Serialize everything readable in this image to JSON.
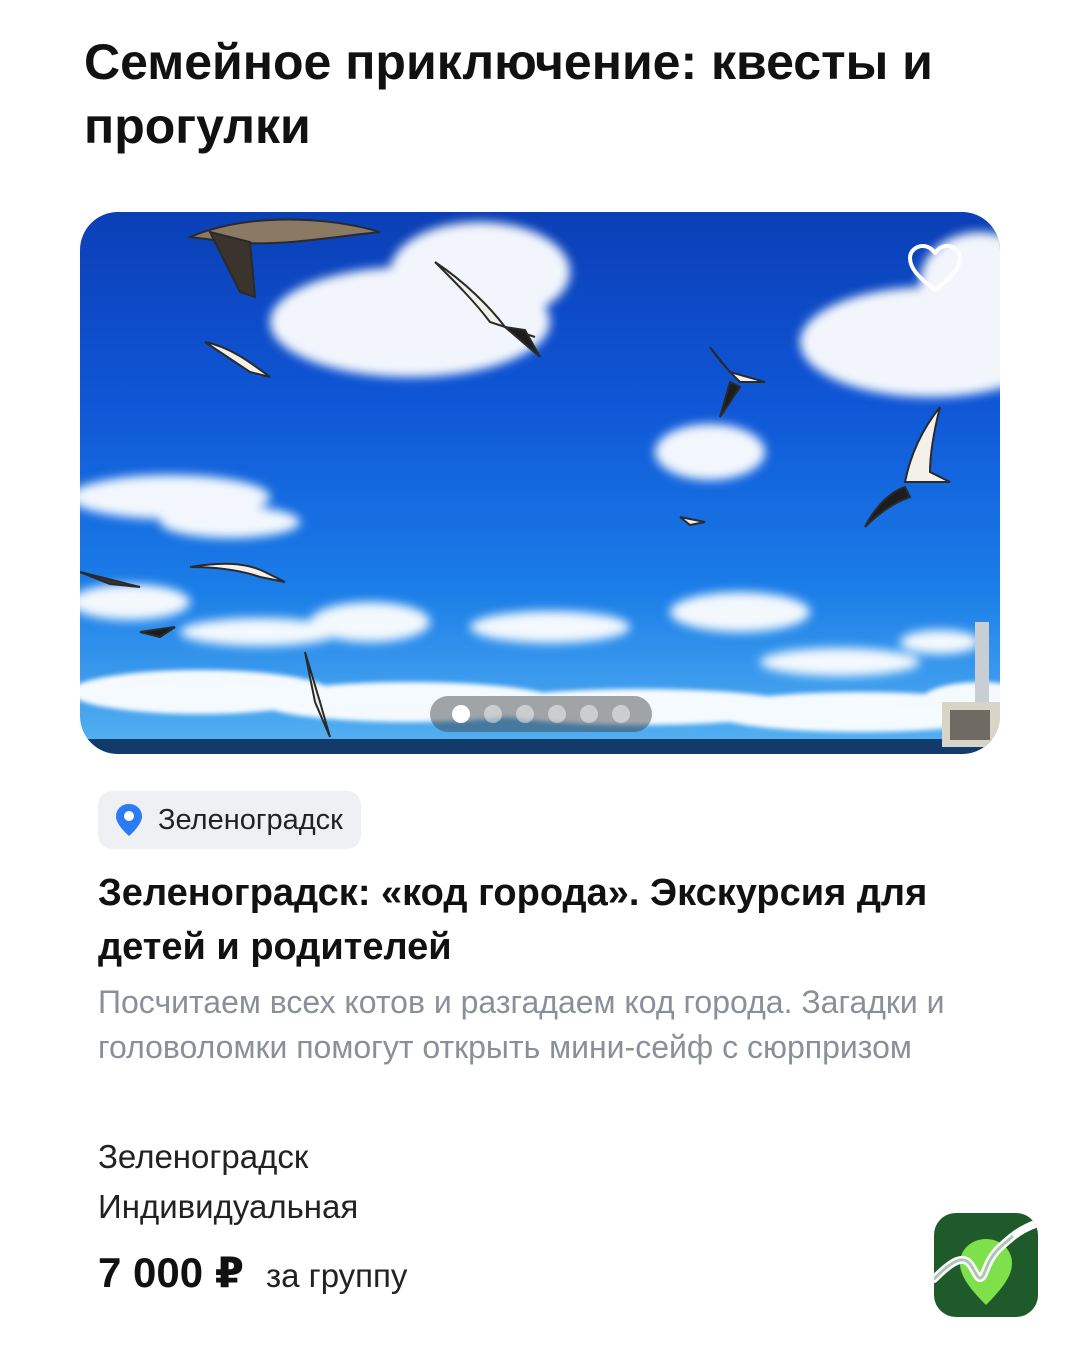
{
  "page": {
    "title": "Семейное приключение: квесты и прогулки"
  },
  "card": {
    "image": {
      "description_icon": "seagulls-sky-photo",
      "favorite_icon": "heart-outline-icon",
      "slides_total": 6,
      "active_slide": 1
    },
    "location_chip": "Зеленоградск",
    "title": "Зеленоградск: «код города». Экскурсия для детей и родителей",
    "description": "Посчитаем всех котов и разгадаем код города. Загадки и головоломки помогут открыть мини-сейф с сюрпризом",
    "city": "Зеленоградск",
    "format": "Индивидуальная",
    "price": "7 000 ₽",
    "price_unit": "за группу"
  },
  "colors": {
    "pin_blue": "#2b7cf3",
    "logo_green": "#1f5a2b",
    "logo_lime": "#7ee04a",
    "description_gray": "#8a8f99"
  }
}
